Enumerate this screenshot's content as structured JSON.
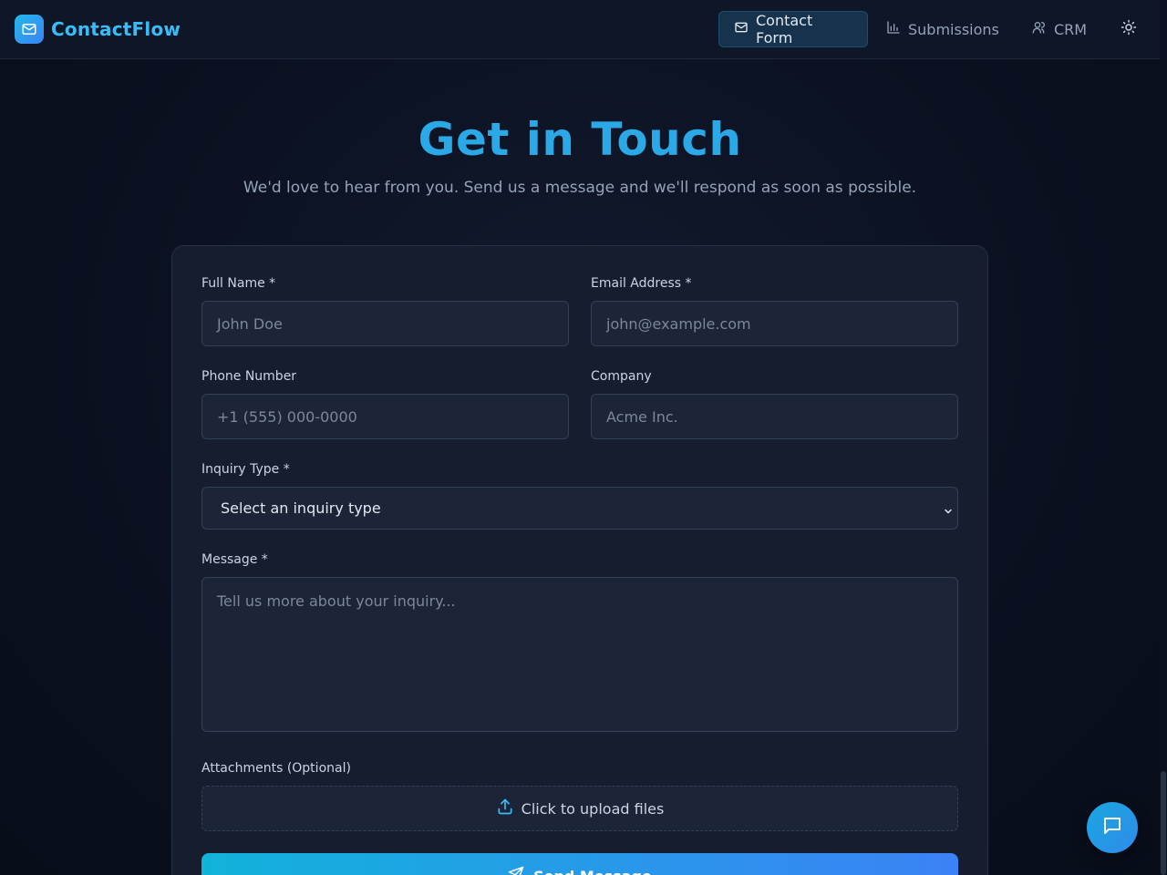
{
  "nav": {
    "brand": "ContactFlow",
    "brand_icon": "mail-icon",
    "items": [
      {
        "label": "Contact Form",
        "icon": "mail-icon",
        "active": true
      },
      {
        "label": "Submissions",
        "icon": "bar-chart-icon",
        "active": false
      },
      {
        "label": "CRM",
        "icon": "users-icon",
        "active": false
      }
    ],
    "theme_icon": "sun-icon"
  },
  "hero": {
    "title": "Get in Touch",
    "subtitle": "We'd love to hear from you. Send us a message and we'll respond as soon as possible."
  },
  "form": {
    "full_name": {
      "label": "Full Name *",
      "placeholder": "John Doe"
    },
    "email": {
      "label": "Email Address *",
      "placeholder": "john@example.com"
    },
    "phone": {
      "label": "Phone Number",
      "placeholder": "+1 (555) 000-0000"
    },
    "company": {
      "label": "Company",
      "placeholder": "Acme Inc."
    },
    "inquiry": {
      "label": "Inquiry Type *",
      "value": "Select an inquiry type"
    },
    "message": {
      "label": "Message *",
      "placeholder": "Tell us more about your inquiry..."
    },
    "attachments": {
      "label": "Attachments (Optional)",
      "button": "Click to upload files"
    },
    "submit": "Send Message"
  },
  "colors": {
    "accent": "#38bdf8",
    "background": "#0b1120",
    "card": "#151d2e"
  }
}
